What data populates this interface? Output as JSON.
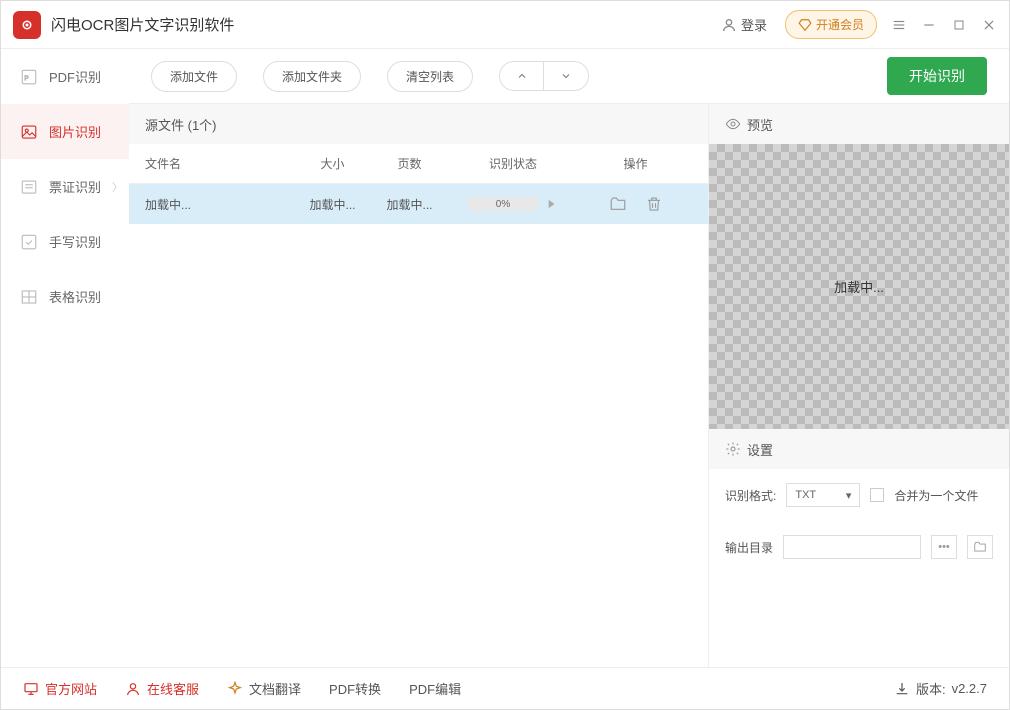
{
  "titlebar": {
    "app_title": "闪电OCR图片文字识别软件",
    "login": "登录",
    "vip": "开通会员"
  },
  "sidebar": {
    "items": [
      {
        "label": "PDF识别",
        "has_chevron": false
      },
      {
        "label": "图片识别",
        "has_chevron": false
      },
      {
        "label": "票证识别",
        "has_chevron": true
      },
      {
        "label": "手写识别",
        "has_chevron": false
      },
      {
        "label": "表格识别",
        "has_chevron": false
      }
    ]
  },
  "toolbar": {
    "add_file": "添加文件",
    "add_folder": "添加文件夹",
    "clear_list": "清空列表",
    "start": "开始识别"
  },
  "files": {
    "header": "源文件 (1个)",
    "columns": {
      "name": "文件名",
      "size": "大小",
      "pages": "页数",
      "status": "识别状态",
      "ops": "操作"
    },
    "rows": [
      {
        "name": "加载中...",
        "size": "加载中...",
        "pages": "加载中...",
        "progress": "0%"
      }
    ]
  },
  "preview": {
    "header": "预览",
    "loading": "加载中..."
  },
  "settings": {
    "header": "设置",
    "format_label": "识别格式:",
    "format_value": "TXT",
    "merge_label": "合并为一个文件",
    "output_label": "输出目录"
  },
  "footer": {
    "website": "官方网站",
    "support": "在线客服",
    "translate": "文档翻译",
    "pdf_convert": "PDF转换",
    "pdf_edit": "PDF编辑",
    "version_label": "版本:",
    "version": "v2.2.7"
  }
}
